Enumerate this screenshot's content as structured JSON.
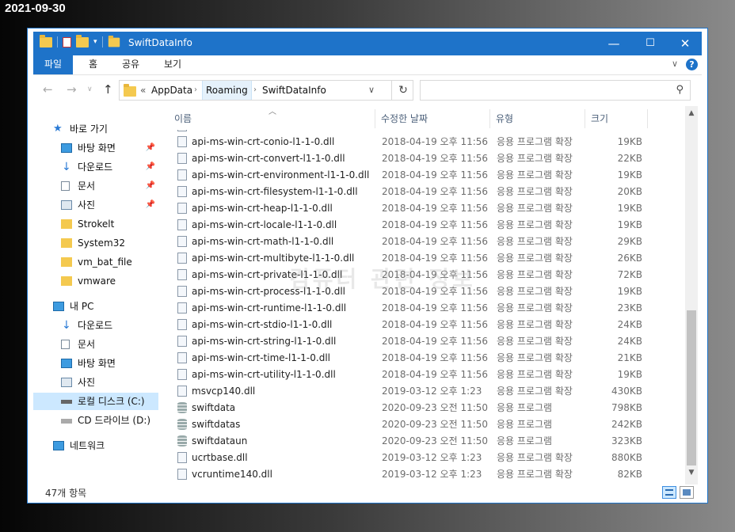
{
  "date_stamp": "2021-09-30",
  "window": {
    "title": "SwiftDataInfo",
    "controls": {
      "minimize": "—",
      "maximize": "☐",
      "close": "✕"
    }
  },
  "ribbon": {
    "tabs": [
      "파일",
      "홈",
      "공유",
      "보기"
    ],
    "active_tab": "파일",
    "help": "?"
  },
  "address": {
    "overflow": "«",
    "segments": [
      "AppData",
      "Roaming",
      "SwiftDataInfo"
    ],
    "search_placeholder": ""
  },
  "sidebar": {
    "quick_access": "바로 가기",
    "items": [
      {
        "label": "바탕 화면",
        "icon": "desktop-icon",
        "pinned": true
      },
      {
        "label": "다운로드",
        "icon": "download-icon",
        "pinned": true
      },
      {
        "label": "문서",
        "icon": "document-icon",
        "pinned": true
      },
      {
        "label": "사진",
        "icon": "picture-icon",
        "pinned": true
      },
      {
        "label": "Strokelt",
        "icon": "folder-icon",
        "pinned": false
      },
      {
        "label": "System32",
        "icon": "folder-icon",
        "pinned": false
      },
      {
        "label": "vm_bat_file",
        "icon": "folder-icon",
        "pinned": false
      },
      {
        "label": "vmware",
        "icon": "folder-icon",
        "pinned": false
      }
    ],
    "this_pc": "내 PC",
    "pc_items": [
      {
        "label": "다운로드",
        "icon": "download-icon"
      },
      {
        "label": "문서",
        "icon": "document-icon"
      },
      {
        "label": "바탕 화면",
        "icon": "desktop-icon"
      },
      {
        "label": "사진",
        "icon": "picture-icon"
      },
      {
        "label": "로컬 디스크 (C:)",
        "icon": "drive-icon",
        "selected": true
      },
      {
        "label": "CD 드라이브 (D:)",
        "icon": "cd-drive-icon"
      }
    ],
    "network": "네트워크"
  },
  "columns": {
    "name": "이름",
    "date": "수정한 날짜",
    "type": "유형",
    "size": "크기"
  },
  "files": [
    {
      "name": "api-ms-win-crt-conio-l1-1-0.dll",
      "date": "2018-04-19 오후 11:56",
      "type": "응용 프로그램 확장",
      "size": "19KB",
      "icon": "dll"
    },
    {
      "name": "api-ms-win-crt-convert-l1-1-0.dll",
      "date": "2018-04-19 오후 11:56",
      "type": "응용 프로그램 확장",
      "size": "22KB",
      "icon": "dll"
    },
    {
      "name": "api-ms-win-crt-environment-l1-1-0.dll",
      "date": "2018-04-19 오후 11:56",
      "type": "응용 프로그램 확장",
      "size": "19KB",
      "icon": "dll"
    },
    {
      "name": "api-ms-win-crt-filesystem-l1-1-0.dll",
      "date": "2018-04-19 오후 11:56",
      "type": "응용 프로그램 확장",
      "size": "20KB",
      "icon": "dll"
    },
    {
      "name": "api-ms-win-crt-heap-l1-1-0.dll",
      "date": "2018-04-19 오후 11:56",
      "type": "응용 프로그램 확장",
      "size": "19KB",
      "icon": "dll"
    },
    {
      "name": "api-ms-win-crt-locale-l1-1-0.dll",
      "date": "2018-04-19 오후 11:56",
      "type": "응용 프로그램 확장",
      "size": "19KB",
      "icon": "dll"
    },
    {
      "name": "api-ms-win-crt-math-l1-1-0.dll",
      "date": "2018-04-19 오후 11:56",
      "type": "응용 프로그램 확장",
      "size": "29KB",
      "icon": "dll"
    },
    {
      "name": "api-ms-win-crt-multibyte-l1-1-0.dll",
      "date": "2018-04-19 오후 11:56",
      "type": "응용 프로그램 확장",
      "size": "26KB",
      "icon": "dll"
    },
    {
      "name": "api-ms-win-crt-private-l1-1-0.dll",
      "date": "2018-04-19 오후 11:56",
      "type": "응용 프로그램 확장",
      "size": "72KB",
      "icon": "dll"
    },
    {
      "name": "api-ms-win-crt-process-l1-1-0.dll",
      "date": "2018-04-19 오후 11:56",
      "type": "응용 프로그램 확장",
      "size": "19KB",
      "icon": "dll"
    },
    {
      "name": "api-ms-win-crt-runtime-l1-1-0.dll",
      "date": "2018-04-19 오후 11:56",
      "type": "응용 프로그램 확장",
      "size": "23KB",
      "icon": "dll"
    },
    {
      "name": "api-ms-win-crt-stdio-l1-1-0.dll",
      "date": "2018-04-19 오후 11:56",
      "type": "응용 프로그램 확장",
      "size": "24KB",
      "icon": "dll"
    },
    {
      "name": "api-ms-win-crt-string-l1-1-0.dll",
      "date": "2018-04-19 오후 11:56",
      "type": "응용 프로그램 확장",
      "size": "24KB",
      "icon": "dll"
    },
    {
      "name": "api-ms-win-crt-time-l1-1-0.dll",
      "date": "2018-04-19 오후 11:56",
      "type": "응용 프로그램 확장",
      "size": "21KB",
      "icon": "dll"
    },
    {
      "name": "api-ms-win-crt-utility-l1-1-0.dll",
      "date": "2018-04-19 오후 11:56",
      "type": "응용 프로그램 확장",
      "size": "19KB",
      "icon": "dll"
    },
    {
      "name": "msvcp140.dll",
      "date": "2019-03-12 오후 1:23",
      "type": "응용 프로그램 확장",
      "size": "430KB",
      "icon": "dll"
    },
    {
      "name": "swiftdata",
      "date": "2020-09-23 오전 11:50",
      "type": "응용 프로그램",
      "size": "798KB",
      "icon": "db"
    },
    {
      "name": "swiftdatas",
      "date": "2020-09-23 오전 11:50",
      "type": "응용 프로그램",
      "size": "242KB",
      "icon": "db"
    },
    {
      "name": "swiftdataun",
      "date": "2020-09-23 오전 11:50",
      "type": "응용 프로그램",
      "size": "323KB",
      "icon": "db"
    },
    {
      "name": "ucrtbase.dll",
      "date": "2019-03-12 오후 1:23",
      "type": "응용 프로그램 확장",
      "size": "880KB",
      "icon": "dll"
    },
    {
      "name": "vcruntime140.dll",
      "date": "2019-03-12 오후 1:23",
      "type": "응용 프로그램 확장",
      "size": "82KB",
      "icon": "dll"
    }
  ],
  "status": {
    "item_count": "47개 항목"
  },
  "watermark": "컴퓨터 관련 정보",
  "colors": {
    "accent": "#1e73c9",
    "selected": "#cce8ff"
  }
}
